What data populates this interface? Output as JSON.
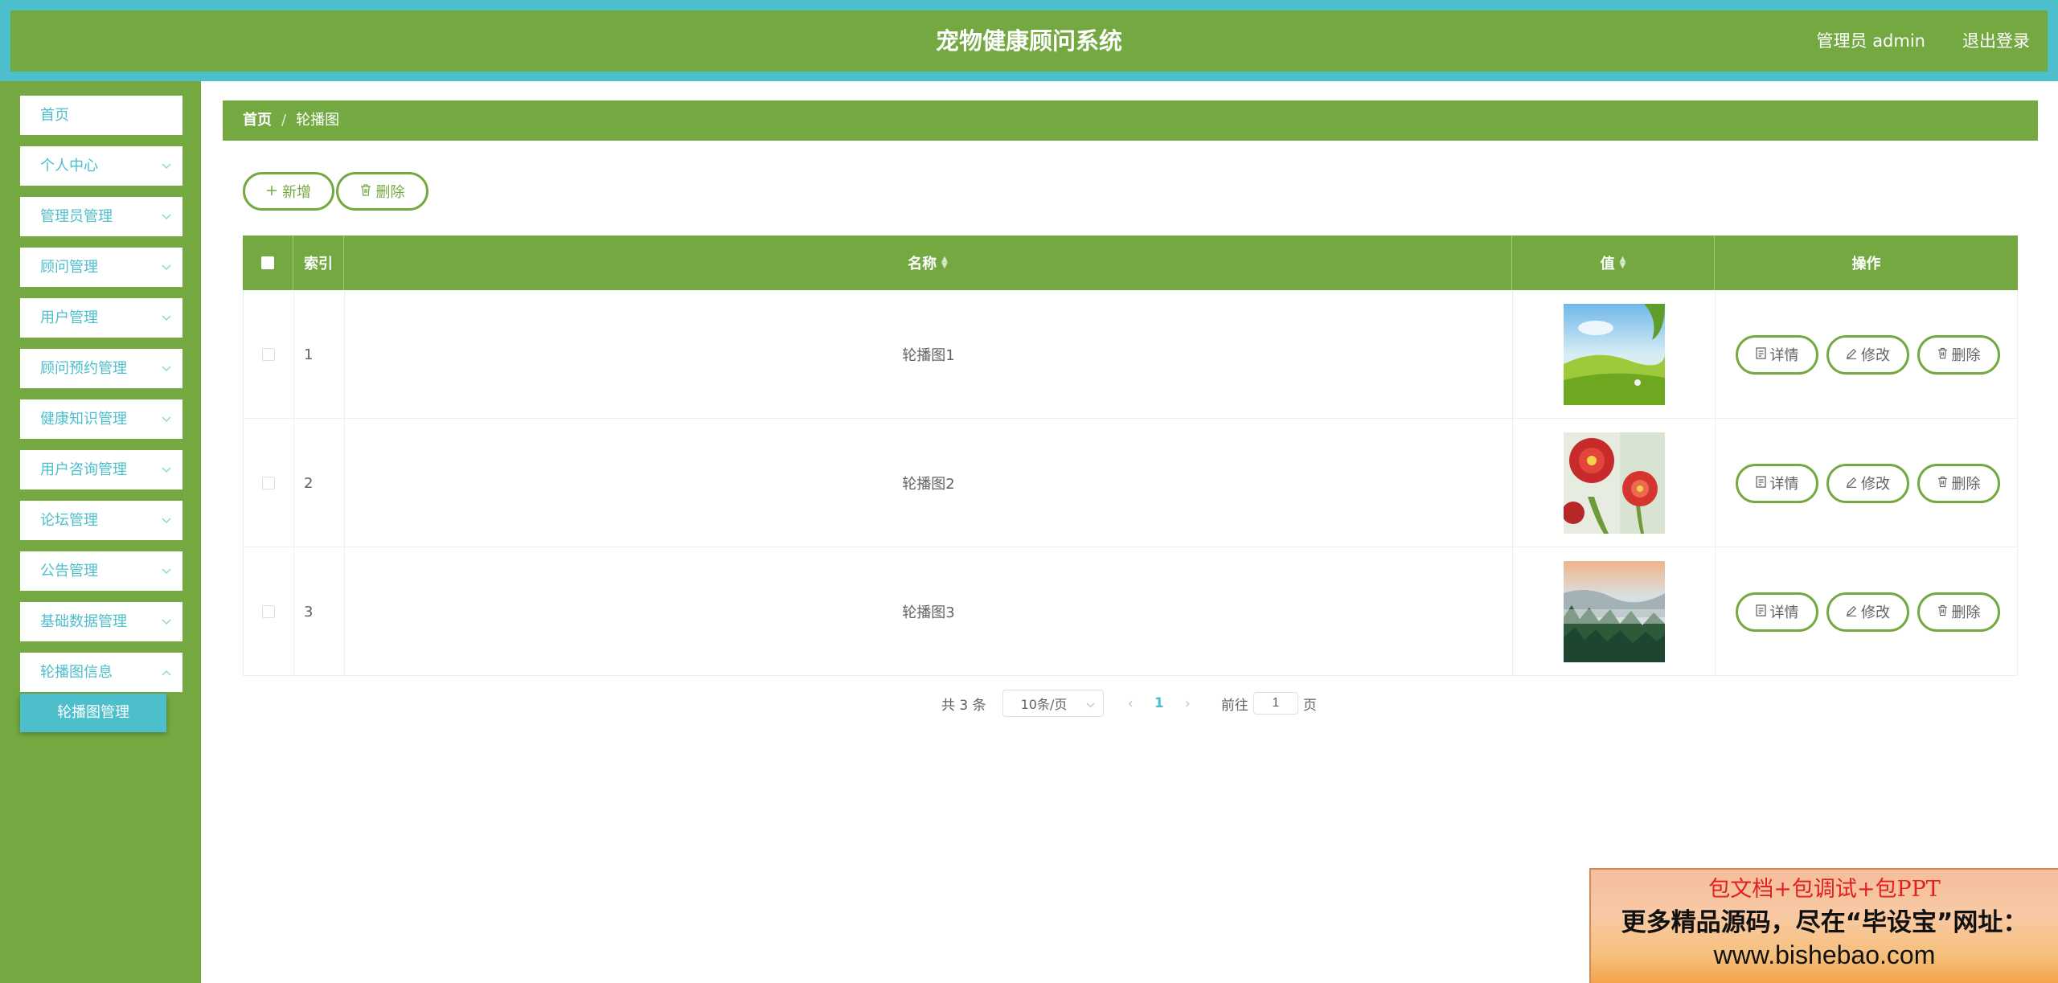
{
  "header": {
    "title": "宠物健康顾问系统",
    "user": "管理员 admin",
    "logout": "退出登录"
  },
  "sidebar": {
    "items": [
      {
        "label": "首页"
      },
      {
        "label": "个人中心"
      },
      {
        "label": "管理员管理"
      },
      {
        "label": "顾问管理"
      },
      {
        "label": "用户管理"
      },
      {
        "label": "顾问预约管理"
      },
      {
        "label": "健康知识管理"
      },
      {
        "label": "用户咨询管理"
      },
      {
        "label": "论坛管理"
      },
      {
        "label": "公告管理"
      },
      {
        "label": "基础数据管理"
      },
      {
        "label": "轮播图信息"
      }
    ],
    "active_sub": "轮播图管理"
  },
  "breadcrumb": {
    "home": "首页",
    "separator": "/",
    "current": "轮播图"
  },
  "toolbar": {
    "add_label": "新增",
    "delete_label": "删除"
  },
  "table": {
    "columns": {
      "index": "索引",
      "name": "名称",
      "value": "值",
      "actions": "操作"
    },
    "rows": [
      {
        "index": "1",
        "name": "轮播图1",
        "image": "meadow"
      },
      {
        "index": "2",
        "name": "轮播图2",
        "image": "flowers"
      },
      {
        "index": "3",
        "name": "轮播图3",
        "image": "misty-forest"
      }
    ],
    "row_actions": {
      "detail": "详情",
      "edit": "修改",
      "delete": "删除"
    }
  },
  "pagination": {
    "total": "共 3 条",
    "page_size": "10条/页",
    "current_page": "1",
    "goto_label": "前往",
    "goto_value": "1",
    "page_suffix": "页"
  },
  "watermark": {
    "line1": "包文档+包调试+包PPT",
    "line2": "更多精品源码，尽在“毕设宝”网址：",
    "line3": "www.bishebao.com"
  },
  "colors": {
    "primary_green": "#74a942",
    "accent_cyan": "#4dbfcc"
  }
}
